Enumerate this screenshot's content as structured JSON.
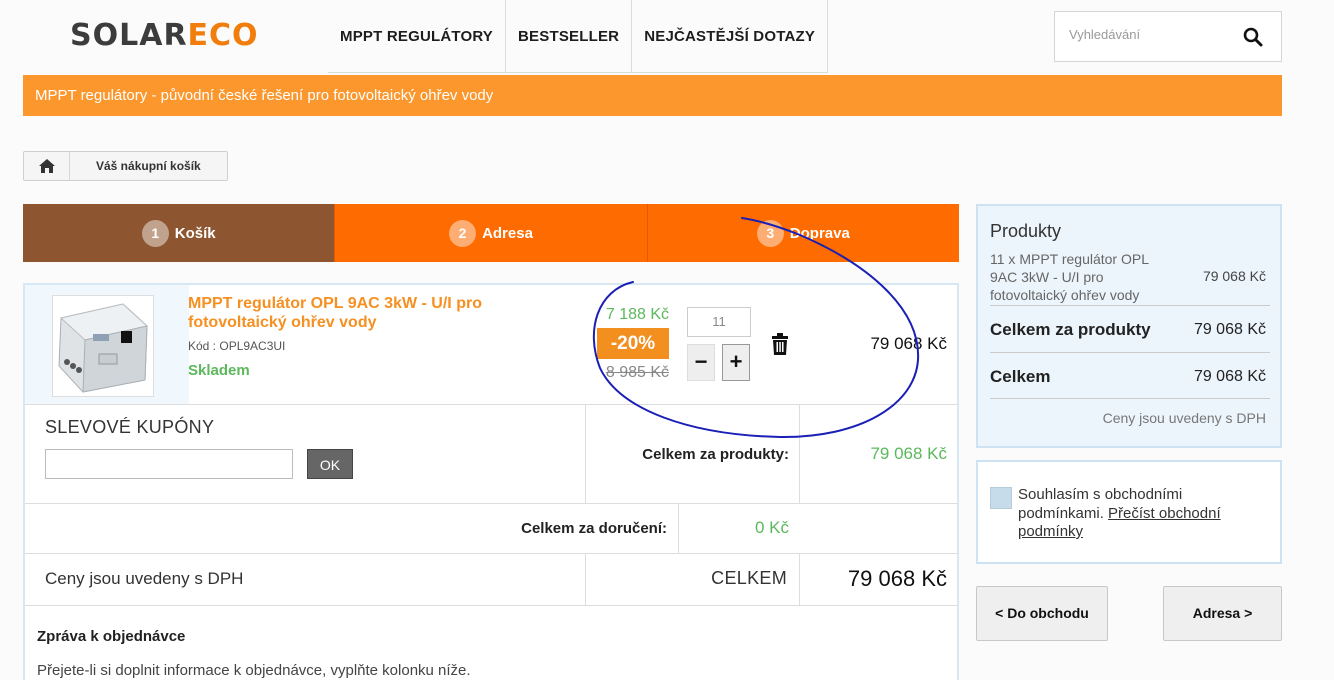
{
  "header": {
    "logo_left": "SOLAR",
    "logo_right": "ECO",
    "nav": [
      "MPPT REGULÁTORY",
      "BESTSELLER",
      "NEJČASTĚJŠÍ DOTAZY"
    ],
    "search_placeholder": "Vyhledávání",
    "search_icon": "search-icon"
  },
  "banner": "MPPT regulátory - původní české řešení pro fotovoltaický ohřev vody",
  "breadcrumb": {
    "home_icon": "home-icon",
    "current": "Váš nákupní košík"
  },
  "steps": [
    {
      "num": "1",
      "label": "Košík",
      "active": true
    },
    {
      "num": "2",
      "label": "Adresa",
      "active": false
    },
    {
      "num": "3",
      "label": "Doprava",
      "active": false
    }
  ],
  "cart": {
    "item": {
      "name": "MPPT regulátor OPL 9AC 3kW - U/I pro fotovoltaický ohřev vody",
      "code": "Kód : OPL9AC3UI",
      "stock": "Skladem",
      "price_new": "7 188 Kč",
      "discount": "-20%",
      "price_old": "8 985 Kč",
      "quantity": "11",
      "minus": "−",
      "plus": "+",
      "total": "79 068 Kč"
    },
    "coupon_title": "SLEVOVÉ KUPÓNY",
    "coupon_ok": "OK",
    "products_total_label": "Celkem za produkty:",
    "products_total_value": "79 068 Kč",
    "delivery_label": "Celkem za doručení:",
    "delivery_value": "0 Kč",
    "vat_note": "Ceny jsou uvedeny s DPH",
    "total_label": "CELKEM",
    "total_value": "79 068 Kč",
    "message_title": "Zpráva k objednávce",
    "message_text": "Přejete-li si doplnit informace k objednávce, vyplňte kolonku níže."
  },
  "summary": {
    "title": "Produkty",
    "item": "11 x MPPT regulátor OPL 9AC 3kW - U/I pro fotovoltaický ohřev vody",
    "item_price": "79 068 Kč",
    "products_label": "Celkem za produkty",
    "products_value": "79 068 Kč",
    "total_label": "Celkem",
    "total_value": "79 068 Kč",
    "vat_note": "Ceny jsou uvedeny s DPH"
  },
  "terms": {
    "text": "Souhlasím s obchodními podmínkami.",
    "link": "Přečíst obchodní podmínky"
  },
  "buttons": {
    "back": "< Do obchodu",
    "next": "Adresa >"
  },
  "colors": {
    "orange": "#fe6b00",
    "brown": "#8d5630",
    "green": "#5cb85c",
    "banner": "#fb972d",
    "annotation": "#1a1fb5"
  }
}
